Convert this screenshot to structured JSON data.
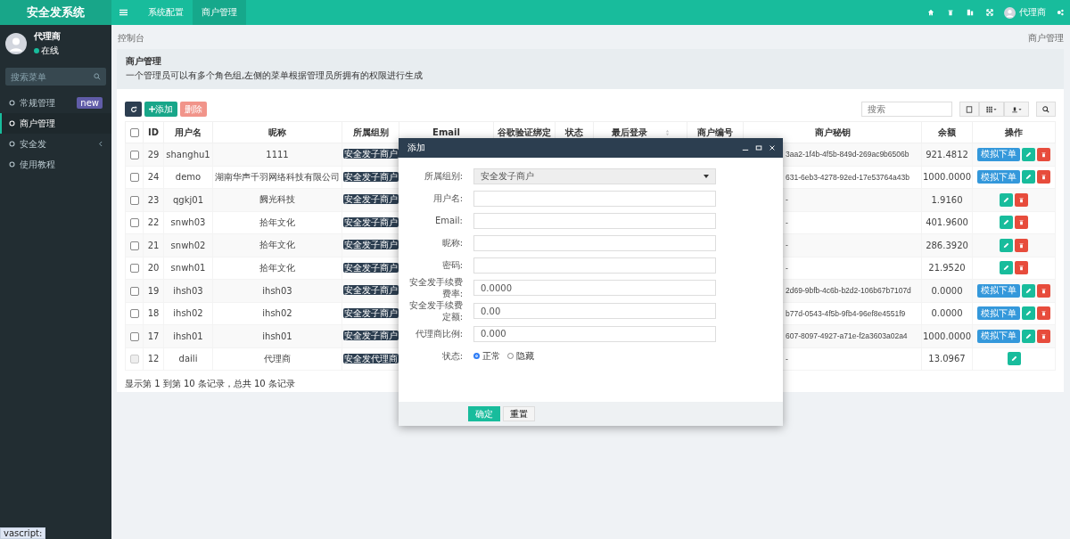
{
  "brand": "安全发系统",
  "topnav": {
    "tabs": [
      {
        "label": "系统配置",
        "selected": false
      },
      {
        "label": "商户管理",
        "selected": true
      }
    ],
    "user": "代理商"
  },
  "sidebar": {
    "user": {
      "name": "代理商",
      "status": "在线"
    },
    "search": {
      "placeholder": "搜索菜单"
    },
    "items": [
      {
        "label": "常规管理",
        "badge": "new",
        "selected": false,
        "expandable": false
      },
      {
        "label": "商户管理",
        "selected": true,
        "expandable": false
      },
      {
        "label": "安全发",
        "selected": false,
        "expandable": true
      },
      {
        "label": "使用教程",
        "selected": false,
        "expandable": false
      }
    ]
  },
  "breadcrumb": {
    "home": "控制台",
    "current": "商户管理"
  },
  "panel": {
    "title": "商户管理",
    "description": "一个管理员可以有多个角色组,左侧的菜单根据管理员所拥有的权限进行生成"
  },
  "toolbar": {
    "add": "添加",
    "delete": "删除",
    "search_placeholder": "搜索"
  },
  "table": {
    "all_checked": false,
    "columns": [
      "ID",
      "用户名",
      "昵称",
      "所属组别",
      "Email",
      "谷歌验证绑定",
      "状态",
      "最后登录",
      "商户编号",
      "商户秘钥",
      "余额",
      "操作"
    ],
    "rows": [
      {
        "checked": false,
        "disabled": false,
        "id": "29",
        "username": "shanghu1",
        "nickname": "1111",
        "group": "安全发子商户",
        "secret": "3aa2-1f4b-4f5b-849d-269ac9b6506b",
        "balance": "921.4812",
        "simulate": "模拟下单",
        "can_delete": true
      },
      {
        "checked": false,
        "disabled": false,
        "id": "24",
        "username": "demo",
        "nickname": "湖南华声千羽网络科技有限公司",
        "group": "安全发子商户",
        "secret": "631-6eb3-4278-92ed-17e53764a43b",
        "balance": "1000.0000",
        "simulate": "模拟下单",
        "can_delete": true
      },
      {
        "checked": false,
        "disabled": false,
        "id": "23",
        "username": "qgkj01",
        "nickname": "阙光科技",
        "group": "安全发子商户",
        "secret": "-",
        "balance": "1.9160",
        "can_delete": true
      },
      {
        "checked": false,
        "disabled": false,
        "id": "22",
        "username": "snwh03",
        "nickname": "拾年文化",
        "group": "安全发子商户",
        "secret": "-",
        "balance": "401.9600",
        "can_delete": true
      },
      {
        "checked": false,
        "disabled": false,
        "id": "21",
        "username": "snwh02",
        "nickname": "拾年文化",
        "group": "安全发子商户",
        "secret": "-",
        "balance": "286.3920",
        "can_delete": true
      },
      {
        "checked": false,
        "disabled": false,
        "id": "20",
        "username": "snwh01",
        "nickname": "拾年文化",
        "group": "安全发子商户",
        "secret": "-",
        "balance": "21.9520",
        "can_delete": true
      },
      {
        "checked": false,
        "disabled": false,
        "id": "19",
        "username": "ihsh03",
        "nickname": "ihsh03",
        "group": "安全发子商户",
        "secret": "2d69-9bfb-4c6b-b2d2-106b67b7107d",
        "balance": "0.0000",
        "simulate": "模拟下单",
        "can_delete": true
      },
      {
        "checked": false,
        "disabled": false,
        "id": "18",
        "username": "ihsh02",
        "nickname": "ihsh02",
        "group": "安全发子商户",
        "secret": "b77d-0543-4f5b-9fb4-96ef8e4551f9",
        "balance": "0.0000",
        "simulate": "模拟下单",
        "can_delete": true
      },
      {
        "checked": false,
        "disabled": false,
        "id": "17",
        "username": "ihsh01",
        "nickname": "ihsh01",
        "group": "安全发子商户",
        "secret": "607-8097-4927-a71e-f2a3603a02a4",
        "balance": "1000.0000",
        "simulate": "模拟下单",
        "can_delete": true
      },
      {
        "checked": false,
        "disabled": true,
        "id": "12",
        "username": "daili",
        "nickname": "代理商",
        "group": "安全发代理商",
        "secret": "-",
        "balance": "13.0967",
        "can_delete": false
      }
    ],
    "footer": "显示第 1 到第 10 条记录，总共 10 条记录"
  },
  "dialog": {
    "title": "添加",
    "fields": [
      {
        "kind": "select",
        "label": "所属组别:",
        "value": "安全发子商户"
      },
      {
        "kind": "text",
        "label": "用户名:"
      },
      {
        "kind": "text",
        "label": "Email:"
      },
      {
        "kind": "text",
        "label": "昵称:"
      },
      {
        "kind": "text",
        "label": "密码:"
      },
      {
        "kind": "text",
        "label": "安全发手续费费率:",
        "value": "0.0000"
      },
      {
        "kind": "text",
        "label": "安全发手续费定额:",
        "value": "0.00"
      },
      {
        "kind": "text",
        "label": "代理商比例:",
        "value": "0.000"
      },
      {
        "kind": "radio",
        "label": "状态:",
        "options": [
          {
            "label": "正常",
            "selected": true
          },
          {
            "label": "隐藏",
            "selected": false
          }
        ]
      }
    ],
    "buttons": [
      {
        "label": "确定",
        "primary": true
      },
      {
        "label": "重置",
        "primary": false
      }
    ]
  },
  "status_url": "vascript:"
}
